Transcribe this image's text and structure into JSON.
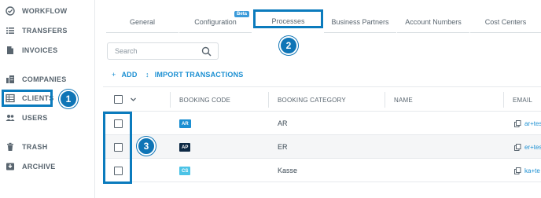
{
  "sidebar": {
    "items": [
      {
        "label": "WORKFLOW",
        "icon": "check-circle-icon"
      },
      {
        "label": "TRANSFERS",
        "icon": "list-icon"
      },
      {
        "label": "INVOICES",
        "icon": "document-icon"
      },
      {
        "label": "COMPANIES",
        "icon": "building-icon"
      },
      {
        "label": "CLIENTS",
        "icon": "clients-grid-icon"
      },
      {
        "label": "USERS",
        "icon": "users-icon"
      },
      {
        "label": "TRASH",
        "icon": "trash-icon"
      },
      {
        "label": "ARCHIVE",
        "icon": "archive-icon"
      }
    ]
  },
  "tabs": [
    {
      "label": "General"
    },
    {
      "label": "Configuration",
      "badge": "Beta"
    },
    {
      "label": "Processes"
    },
    {
      "label": "Business Partners"
    },
    {
      "label": "Account Numbers"
    },
    {
      "label": "Cost Centers"
    }
  ],
  "search": {
    "placeholder": "Search"
  },
  "actions": {
    "add": "ADD",
    "import": "IMPORT TRANSACTIONS"
  },
  "table": {
    "columns": [
      "BOOKING CODE",
      "BOOKING CATEGORY",
      "NAME",
      "EMAIL"
    ],
    "rows": [
      {
        "code": "AR",
        "code_color": "#1b8fd2",
        "category": "AR",
        "email": "ar+tes"
      },
      {
        "code": "AP",
        "code_color": "#0e2a45",
        "category": "ER",
        "email": "er+tes"
      },
      {
        "code": "CS",
        "code_color": "#4cc3e6",
        "category": "Kasse",
        "email": "ka+te"
      }
    ]
  },
  "annotations": {
    "step1": "1",
    "step2": "2",
    "step3": "3"
  },
  "colors": {
    "accent": "#0b7bbd",
    "link": "#1b8fd2"
  }
}
